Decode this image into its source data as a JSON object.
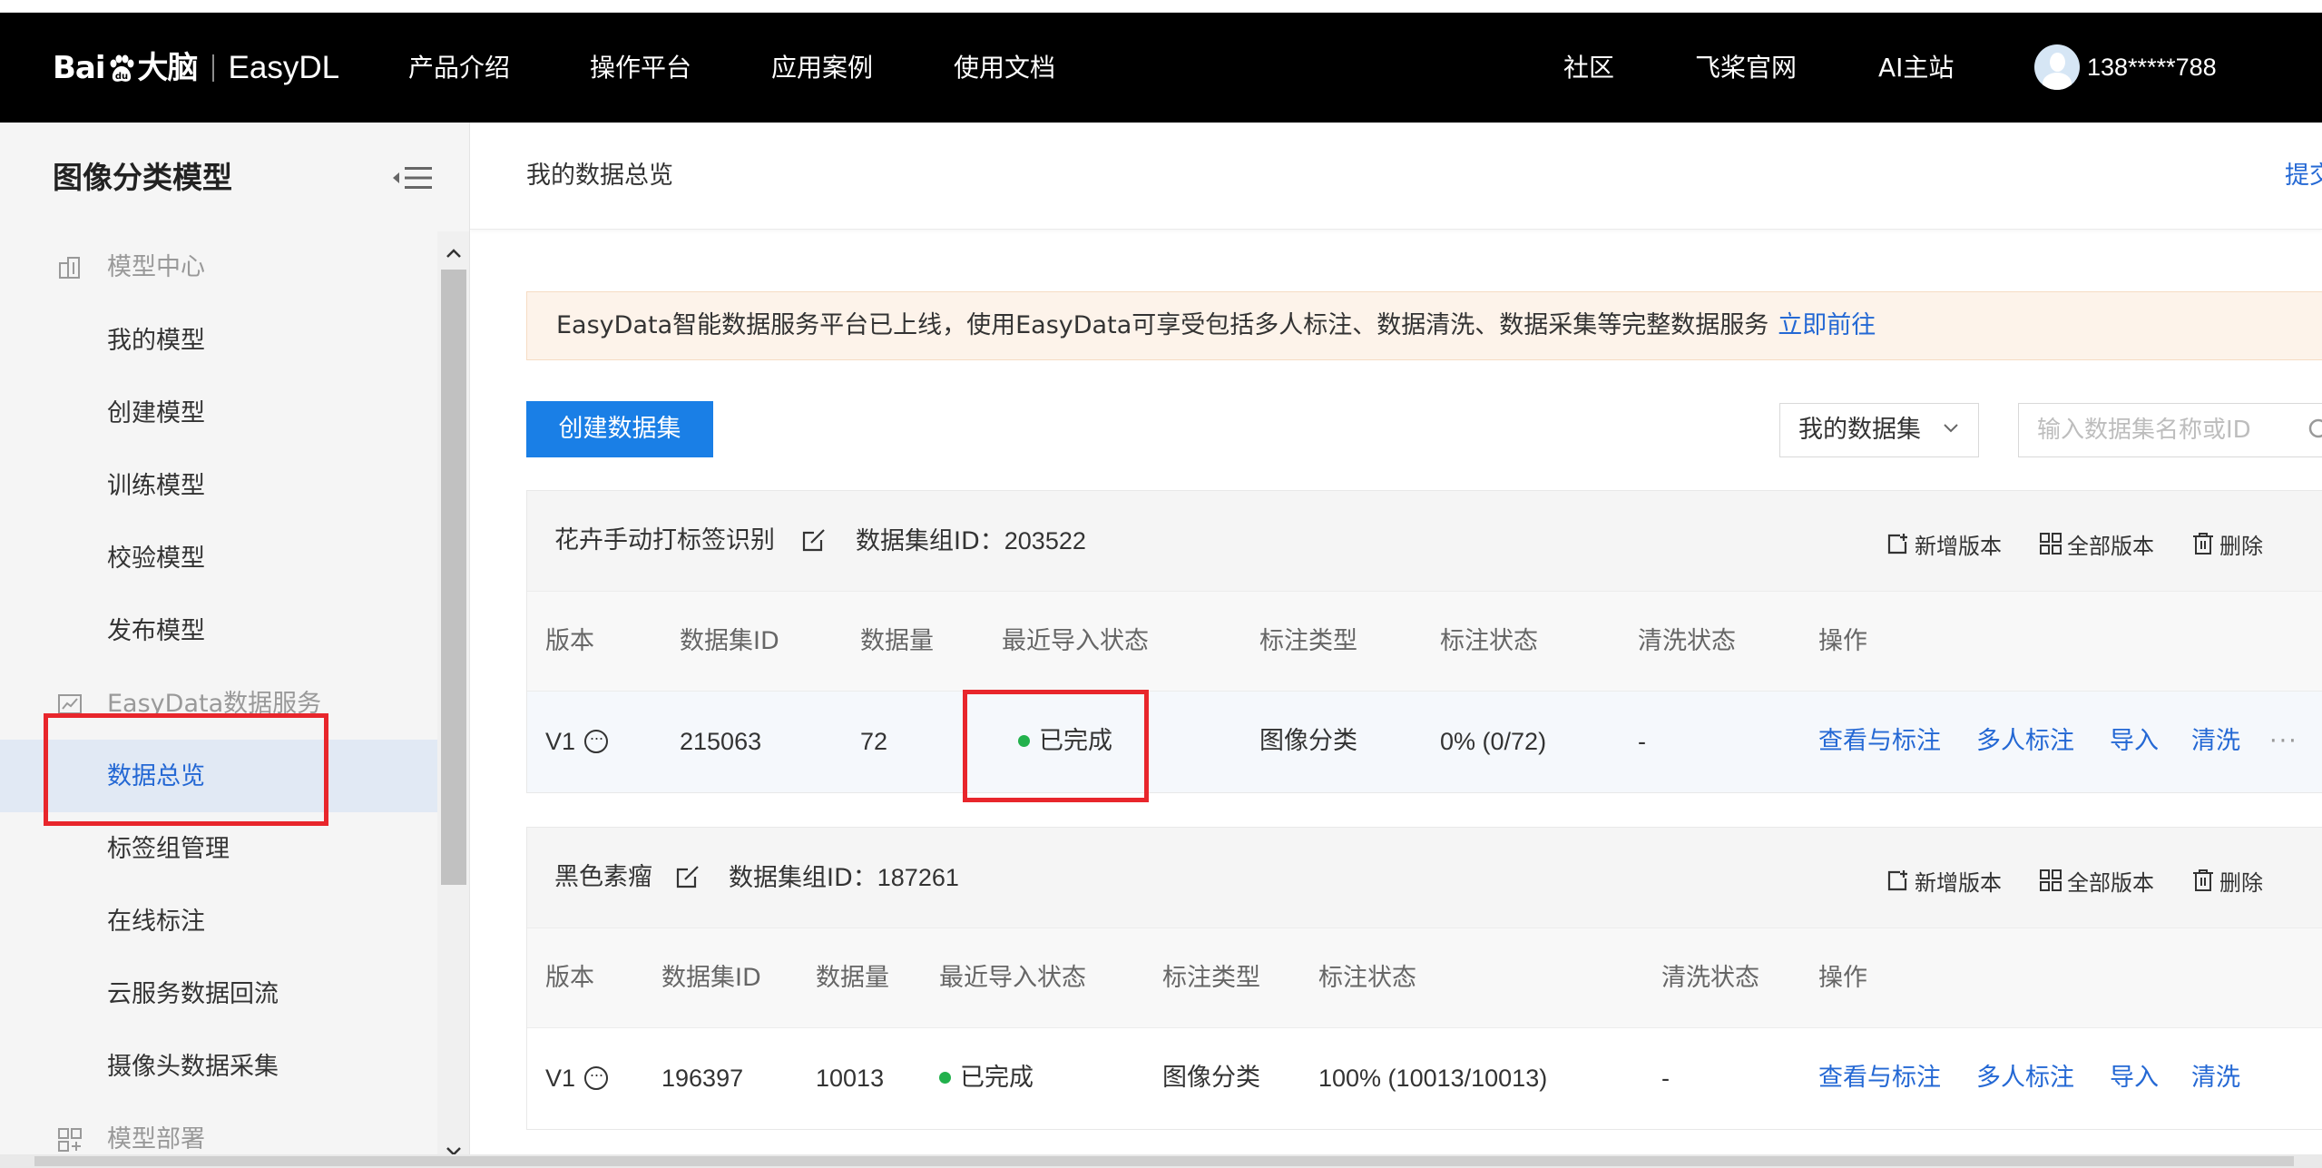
{
  "header": {
    "logo_brand": "Bai",
    "logo_brand_suffix": "大脑",
    "logo_product": "EasyDL",
    "nav": [
      "产品介绍",
      "操作平台",
      "应用案例",
      "使用文档"
    ],
    "nav_right": [
      "社区",
      "飞桨官网",
      "AI主站"
    ],
    "user_phone": "138*****788"
  },
  "sidebar": {
    "title": "图像分类模型",
    "groups": [
      {
        "label": "模型中心",
        "icon": "building-icon",
        "items": [
          "我的模型",
          "创建模型",
          "训练模型",
          "校验模型",
          "发布模型"
        ]
      },
      {
        "label": "EasyData数据服务",
        "icon": "chart-icon",
        "items": [
          "数据总览",
          "标签组管理",
          "在线标注",
          "云服务数据回流",
          "摄像头数据采集"
        ]
      },
      {
        "label": "模型部署",
        "icon": "deploy-icon",
        "items": []
      }
    ],
    "active_item": "数据总览"
  },
  "main": {
    "page_title": "我的数据总览",
    "submit_label": "提交",
    "notice_text": "EasyData智能数据服务平台已上线，使用EasyData可享受包括多人标注、数据清洗、数据采集等完整数据服务",
    "notice_link": "立即前往",
    "create_button": "创建数据集",
    "dataset_filter": "我的数据集",
    "search_placeholder": "输入数据集名称或ID",
    "card_actions": [
      "新增版本",
      "全部版本",
      "删除"
    ],
    "columns": [
      "版本",
      "数据集ID",
      "数据量",
      "最近导入状态",
      "标注类型",
      "标注状态",
      "清洗状态",
      "操作"
    ],
    "row_ops": [
      "查看与标注",
      "多人标注",
      "导入",
      "清洗",
      "···"
    ],
    "datasets": [
      {
        "name": "花卉手动打标签识别",
        "group_id_label": "数据集组ID：",
        "group_id": "203522",
        "version": "V1",
        "dataset_id": "215063",
        "count": "72",
        "import_status": "已完成",
        "label_type": "图像分类",
        "label_status": "0% (0/72)",
        "clean_status": "-"
      },
      {
        "name": "黑色素瘤",
        "group_id_label": "数据集组ID：",
        "group_id": "187261",
        "version": "V1",
        "dataset_id": "196397",
        "count": "10013",
        "import_status": "已完成",
        "label_type": "图像分类",
        "label_status": "100% (10013/10013)",
        "clean_status": "-"
      }
    ]
  },
  "colors": {
    "topbar": "#000000",
    "accent": "#2468d4",
    "primary_button": "#1a7fe6",
    "highlight_box": "#e8262c",
    "status_dot": "#22b14c",
    "notice_bg": "#fdf3ea"
  }
}
